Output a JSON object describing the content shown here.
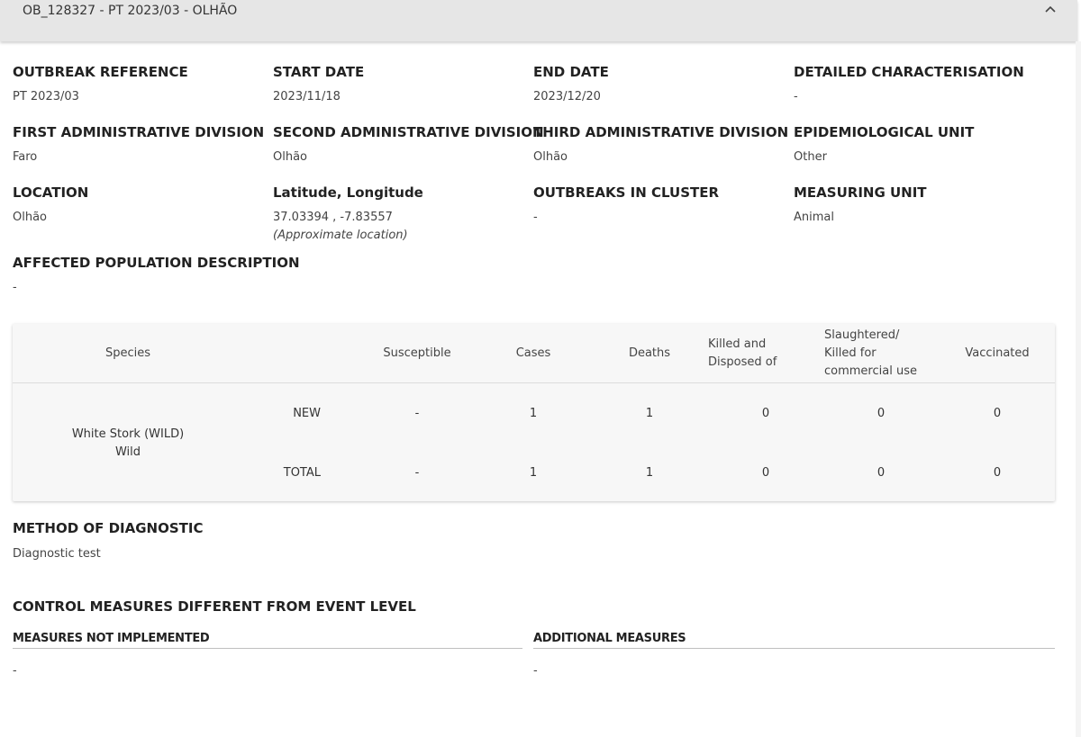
{
  "header": {
    "title": "OB_128327 - PT 2023/03 - OLHÃO"
  },
  "fields": {
    "outbreak_reference": {
      "label": "OUTBREAK REFERENCE",
      "value": "PT 2023/03"
    },
    "start_date": {
      "label": "START DATE",
      "value": "2023/11/18"
    },
    "end_date": {
      "label": "END DATE",
      "value": "2023/12/20"
    },
    "detailed_characterisation": {
      "label": "DETAILED CHARACTERISATION",
      "value": "-"
    },
    "first_admin_division": {
      "label": "FIRST ADMINISTRATIVE DIVISION",
      "value": "Faro"
    },
    "second_admin_division": {
      "label": "SECOND ADMINISTRATIVE DIVISION",
      "value": "Olhão"
    },
    "third_admin_division": {
      "label": "THIRD ADMINISTRATIVE DIVISION",
      "value": "Olhão"
    },
    "epidemiological_unit": {
      "label": "EPIDEMIOLOGICAL UNIT",
      "value": "Other"
    },
    "location": {
      "label": "LOCATION",
      "value": "Olhão"
    },
    "lat_long": {
      "label": "Latitude, Longitude",
      "value": "37.03394 , -7.83557",
      "note": "(Approximate location)"
    },
    "outbreaks_in_cluster": {
      "label": "OUTBREAKS IN CLUSTER",
      "value": "-"
    },
    "measuring_unit": {
      "label": "MEASURING UNIT",
      "value": "Animal"
    },
    "affected_population": {
      "label": "AFFECTED POPULATION DESCRIPTION",
      "value": "-"
    }
  },
  "table": {
    "headers": {
      "species": "Species",
      "susceptible": "Susceptible",
      "cases": "Cases",
      "deaths": "Deaths",
      "killed_line1": "Killed and",
      "killed_line2": "Disposed of",
      "slaughtered_line1": "Slaughtered/",
      "slaughtered_line2": "Killed for",
      "slaughtered_line3": "commercial use",
      "vaccinated": "Vaccinated"
    },
    "species_name": "White Stork (WILD)",
    "species_type": "Wild",
    "rows": [
      {
        "label": "NEW",
        "susceptible": "-",
        "cases": "1",
        "deaths": "1",
        "killed": "0",
        "slaughtered": "0",
        "vaccinated": "0"
      },
      {
        "label": "TOTAL",
        "susceptible": "-",
        "cases": "1",
        "deaths": "1",
        "killed": "0",
        "slaughtered": "0",
        "vaccinated": "0"
      }
    ]
  },
  "diagnostic": {
    "label": "METHOD OF DIAGNOSTIC",
    "value": "Diagnostic test"
  },
  "control_measures": {
    "title": "CONTROL MEASURES DIFFERENT FROM EVENT LEVEL",
    "not_implemented_label": "MEASURES NOT IMPLEMENTED",
    "not_implemented_value": "-",
    "additional_label": "ADDITIONAL MEASURES",
    "additional_value": "-"
  },
  "icons": {
    "collapse": "chevron-up-icon"
  }
}
